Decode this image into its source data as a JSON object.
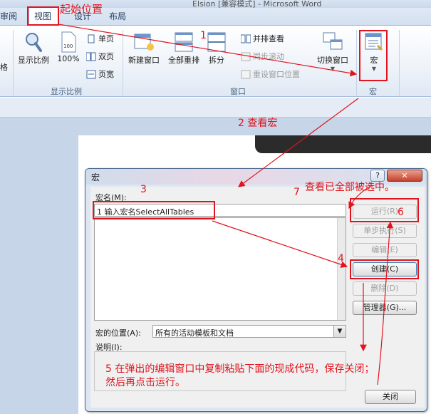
{
  "window": {
    "title_partial": "Elsion [兼容模式] - Microsoft Word"
  },
  "tabs": {
    "review": "审阅",
    "view": "视图",
    "design": "设计",
    "layout": "布局"
  },
  "ribbon": {
    "partial_left": "格",
    "zoom_group": {
      "label": "显示比例",
      "zoom": "显示比例",
      "percent": "100%",
      "percent_icon": "100",
      "one_page": "单页",
      "two_page": "双页",
      "page_width": "页宽"
    },
    "window_group": {
      "label": "窗口",
      "new_window": "新建窗口",
      "arrange_all": "全部重排",
      "split": "拆分",
      "side_by_side": "并排查看",
      "sync_scroll": "同步滚动",
      "reset_position": "重设窗口位置",
      "switch_window": "切换窗口"
    },
    "macro_group": {
      "label": "宏",
      "macros": "宏"
    }
  },
  "dialog": {
    "title": "宏",
    "help_btn": "?",
    "close_btn": "✕",
    "macro_name_label": "宏名(M):",
    "macro_name_value": "1 输入宏名SelectAllTables",
    "location_label": "宏的位置(A):",
    "location_value": "所有的活动模板和文档",
    "description_label": "说明(I):",
    "buttons": {
      "run": "运行(R)",
      "step": "单步执行(S)",
      "edit": "编辑(E)",
      "create": "创建(C)",
      "delete": "删除(D)",
      "organizer": "管理器(G)...",
      "close": "关闭"
    }
  },
  "annotations": {
    "start": "起始位置",
    "n1": "1",
    "n2": "2 查看宏",
    "n3": "3",
    "n4": "4",
    "n5_line1": "5 在弹出的编辑窗口中复制粘贴下面的现成代码，保存关闭；",
    "n5_line2": "然后再点击运行。",
    "n6": "6",
    "n7": "7",
    "selected_note": "查看已全部被选中。"
  },
  "colors": {
    "annotation": "#e0141e",
    "ribbon_bg": "#eef3f9",
    "dialog_bg": "#dde7f3"
  }
}
